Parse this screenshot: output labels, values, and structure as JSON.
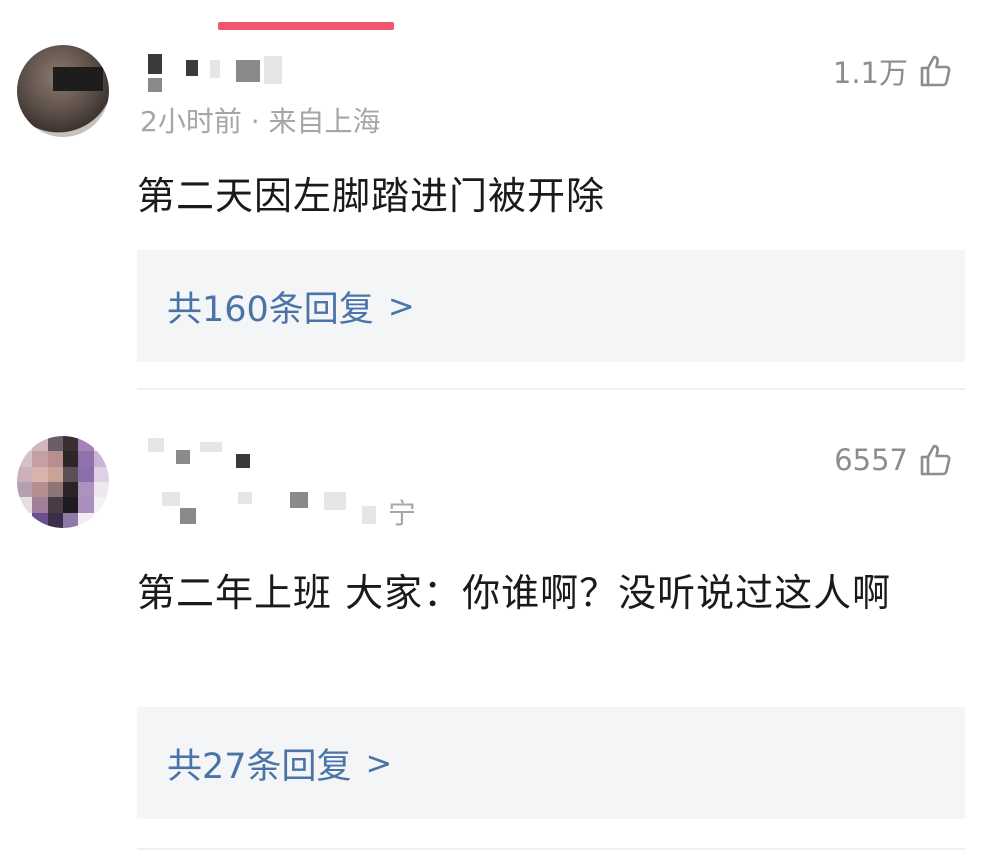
{
  "comments": [
    {
      "likes": "1.1万",
      "meta": "2小时前 · 来自上海",
      "text": "第二天因左脚踏进门被开除",
      "replies": "共160条回复",
      "reply_chevron": ">"
    },
    {
      "likes": "6557",
      "meta": "宁",
      "text": "第二年上班 大家：你谁啊？没听说过这人啊",
      "replies": "共27条回复",
      "reply_chevron": ">"
    }
  ],
  "colors": {
    "accent": "#f0566e",
    "reply_link": "#4a74a8",
    "reply_bg": "#f4f5f7"
  },
  "icons": {
    "like": "thumbs-up-icon"
  }
}
